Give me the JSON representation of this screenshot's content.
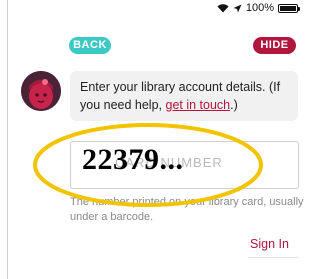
{
  "status_bar": {
    "battery_text": "100%",
    "battery_level": 1.0
  },
  "header": {
    "back_label": "BACK",
    "hide_label": "HIDE"
  },
  "message": {
    "text_before": "Enter your library account details. (If you need help, ",
    "link_text": "get in touch",
    "text_after": ".)"
  },
  "form": {
    "card_input_placeholder": "CARD NUMBER",
    "overlay_value": "22379...",
    "helper_text": "The number printed on your library card, usually under a barcode.",
    "submit_label": "Sign In"
  },
  "colors": {
    "accent_teal": "#3cc8c3",
    "accent_red": "#b2163d",
    "highlight_yellow": "#f2c400"
  }
}
